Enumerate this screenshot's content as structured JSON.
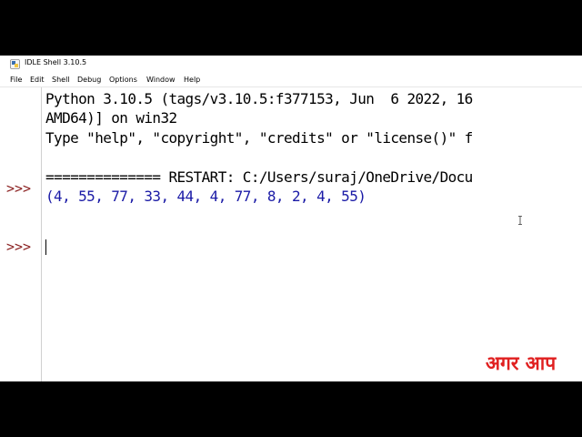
{
  "window": {
    "title": "IDLE Shell 3.10.5"
  },
  "menu": {
    "items": [
      {
        "label": "File"
      },
      {
        "label": "Edit"
      },
      {
        "label": "Shell"
      },
      {
        "label": "Debug"
      },
      {
        "label": "Options"
      },
      {
        "label": "Window"
      },
      {
        "label": "Help"
      }
    ]
  },
  "gutter": {
    "prompts": [
      ">>>",
      ">>>"
    ]
  },
  "shell": {
    "lines": [
      "Python 3.10.5 (tags/v3.10.5:f377153, Jun  6 2022, 16",
      "AMD64)] on win32",
      "Type \"help\", \"copyright\", \"credits\" or \"license()\" f",
      "============== RESTART: C:/Users/suraj/OneDrive/Docu",
      "(4, 55, 77, 33, 44, 4, 77, 8, 2, 4, 55)"
    ]
  },
  "overlay": {
    "text": "अगर आप"
  },
  "colors": {
    "prompt": "#8a1f1f",
    "output": "#1a1aa6",
    "overlay": "#e02020"
  }
}
